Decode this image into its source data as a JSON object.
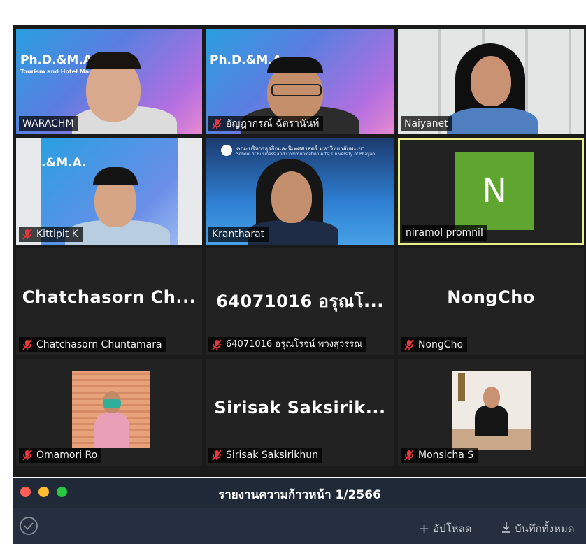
{
  "participants": [
    {
      "name": "WARACHM",
      "muted": false,
      "video": true
    },
    {
      "name": "อัญฎากรณ์ ฉัตรานันท์",
      "muted": true,
      "video": true
    },
    {
      "name": "Naiyanet",
      "muted": false,
      "video": true
    },
    {
      "name": "Kittipit K",
      "muted": true,
      "video": true
    },
    {
      "name": "Krantharat",
      "muted": false,
      "video": true
    },
    {
      "name": "niramol promnil",
      "muted": false,
      "video": false,
      "avatar_letter": "N",
      "active_speaker": true
    },
    {
      "name": "Chatchasorn Chuntamara",
      "display_name": "Chatchasorn  Ch...",
      "muted": true,
      "video": false
    },
    {
      "name": "64071016 อรุณโรจน์ พวงสุวรรณ",
      "display_name": "64071016 อรุณโ...",
      "muted": true,
      "video": false
    },
    {
      "name": "NongCho",
      "display_name": "NongCho",
      "muted": true,
      "video": false
    },
    {
      "name": "Omamori Ro",
      "muted": true,
      "video": true
    },
    {
      "name": "Sirisak Saksirikhun",
      "display_name": "Sirisak  Saksirik...",
      "muted": true,
      "video": false
    },
    {
      "name": "Monsicha S",
      "muted": true,
      "video": true
    }
  ],
  "slide": {
    "title": "Ph.D.&M.A.",
    "title_cropped": ".&M.A.",
    "subtitle": "Tourism and Hotel Management",
    "university": "คณะบริหารธุรกิจและนิเทศศาสตร์ มหาวิทยาลัยพะเยา",
    "university_en": "School of Business and Communication Arts, University of Phayao"
  },
  "window": {
    "title": "รายงานความก้าวหน้า 1/2566",
    "upload_label": "อัปโหลด",
    "save_all_label": "บันทึกทั้งหมด"
  },
  "colors": {
    "active_border": "#e8f08a",
    "avatar_green": "#5ea62f",
    "mute_red": "#e5383b",
    "traffic_red": "#ff5f57",
    "traffic_yellow": "#febc2e",
    "traffic_green": "#28c840"
  }
}
